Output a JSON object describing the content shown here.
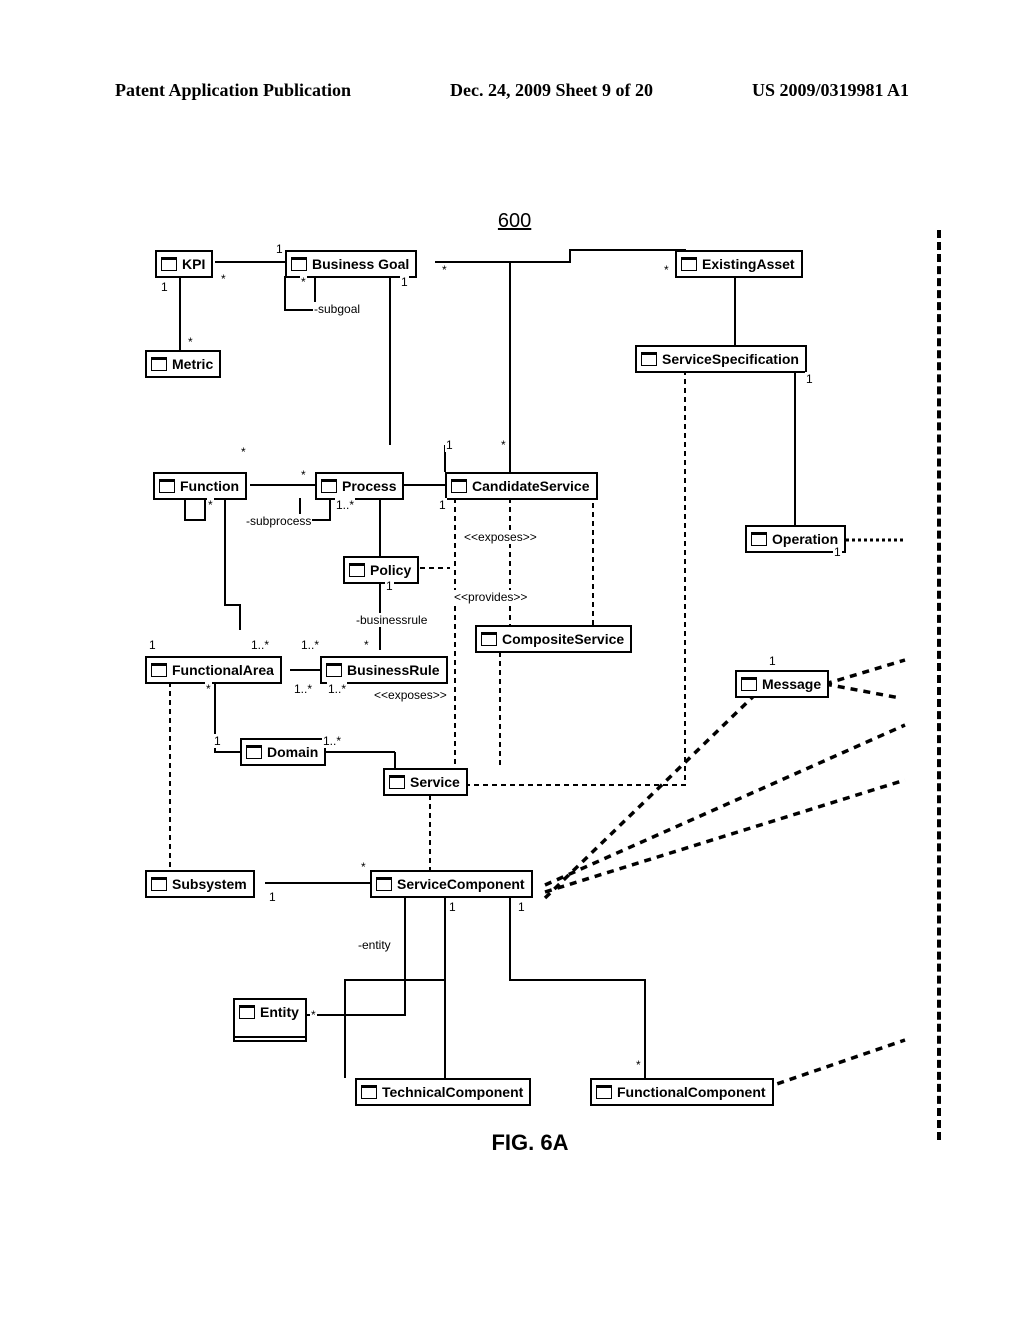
{
  "header": {
    "left": "Patent Application Publication",
    "center": "Dec. 24, 2009  Sheet 9 of 20",
    "right": "US 2009/0319981 A1"
  },
  "figure": {
    "number": "600",
    "caption": "FIG. 6A"
  },
  "classes": {
    "kpi": "KPI",
    "businessGoal": "Business Goal",
    "existingAsset": "ExistingAsset",
    "metric": "Metric",
    "serviceSpecification": "ServiceSpecification",
    "function": "Function",
    "process": "Process",
    "candidateService": "CandidateService",
    "operation": "Operation",
    "policy": "Policy",
    "compositeService": "CompositeService",
    "functionalArea": "FunctionalArea",
    "businessRule": "BusinessRule",
    "message": "Message",
    "service": "Service",
    "domain": "Domain",
    "subsystem": "Subsystem",
    "serviceComponent": "ServiceComponent",
    "entity": "Entity",
    "technicalComponent": "TechnicalComponent",
    "functionalComponent": "FunctionalComponent"
  },
  "labels": {
    "subgoal": "-subgoal",
    "subprocess": "-subprocess",
    "businessrule": "-businessrule",
    "exposes": "<<exposes>>",
    "provides": "<<provides>>",
    "entity": "-entity",
    "one": "1",
    "star": "*",
    "oneStar": "1..*"
  }
}
